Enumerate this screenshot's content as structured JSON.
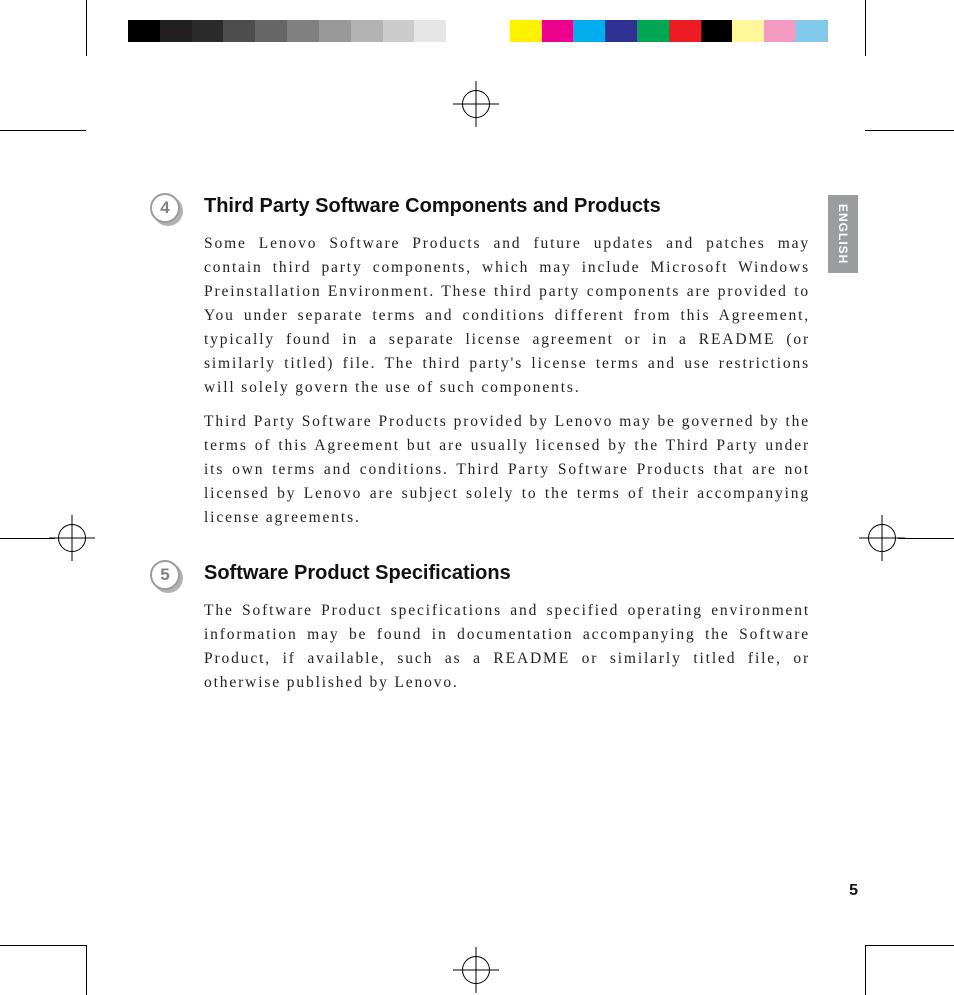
{
  "colorbar": [
    "#000000",
    "#231f20",
    "#2b2b2b",
    "#4d4d4d",
    "#666666",
    "#808080",
    "#999999",
    "#b3b3b3",
    "#cccccc",
    "#e6e6e6",
    "#ffffff",
    "GAP",
    "#fff200",
    "#ec008c",
    "#00aeef",
    "#2e3192",
    "#00a651",
    "#ed1c24",
    "#000000",
    "#fff799",
    "#f49ac1",
    "#82caeb"
  ],
  "language_tab": "ENGLISH",
  "sections": [
    {
      "number": "4",
      "heading": "Third Party Software Components and Products",
      "paragraphs": [
        "Some Lenovo Software Products and future updates and patches may contain third party components, which may include Microsoft Windows Preinstallation Environment. These third party components are provided to You under separate terms and conditions different from this Agreement, typically found in a separate license agreement or in a README (or similarly titled) file. The third party's license terms and use restrictions will solely govern the use of such components.",
        "Third Party Software Products provided by Lenovo may be governed by the terms of this Agreement but are usually licensed by the Third Party under its own terms and conditions.  Third Party Software Products that are not licensed by Lenovo are subject solely to the terms of their accompanying license agreements."
      ]
    },
    {
      "number": "5",
      "heading": "Software Product Specifications",
      "paragraphs": [
        "The Software Product specifications and specified operating environment information may be found in documentation accompanying the Software Product, if available, such as a README or similarly titled file, or otherwise published by Lenovo."
      ]
    }
  ],
  "page_number": "5"
}
